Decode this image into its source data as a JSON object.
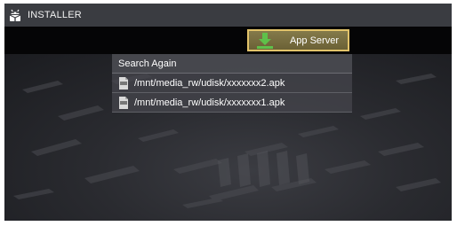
{
  "app": {
    "title": "INSTALLER",
    "logo_icon": "android-package-icon"
  },
  "toolbar": {
    "app_server_label": "App Server",
    "app_server_icon": "download-icon",
    "accent_color": "#e2c36a"
  },
  "list": {
    "search_again_label": "Search Again",
    "files": [
      {
        "path": "/mnt/media_rw/udisk/xxxxxxx2.apk",
        "icon": "apk-file-icon"
      },
      {
        "path": "/mnt/media_rw/udisk/xxxxxxx1.apk",
        "icon": "apk-file-icon"
      }
    ]
  }
}
